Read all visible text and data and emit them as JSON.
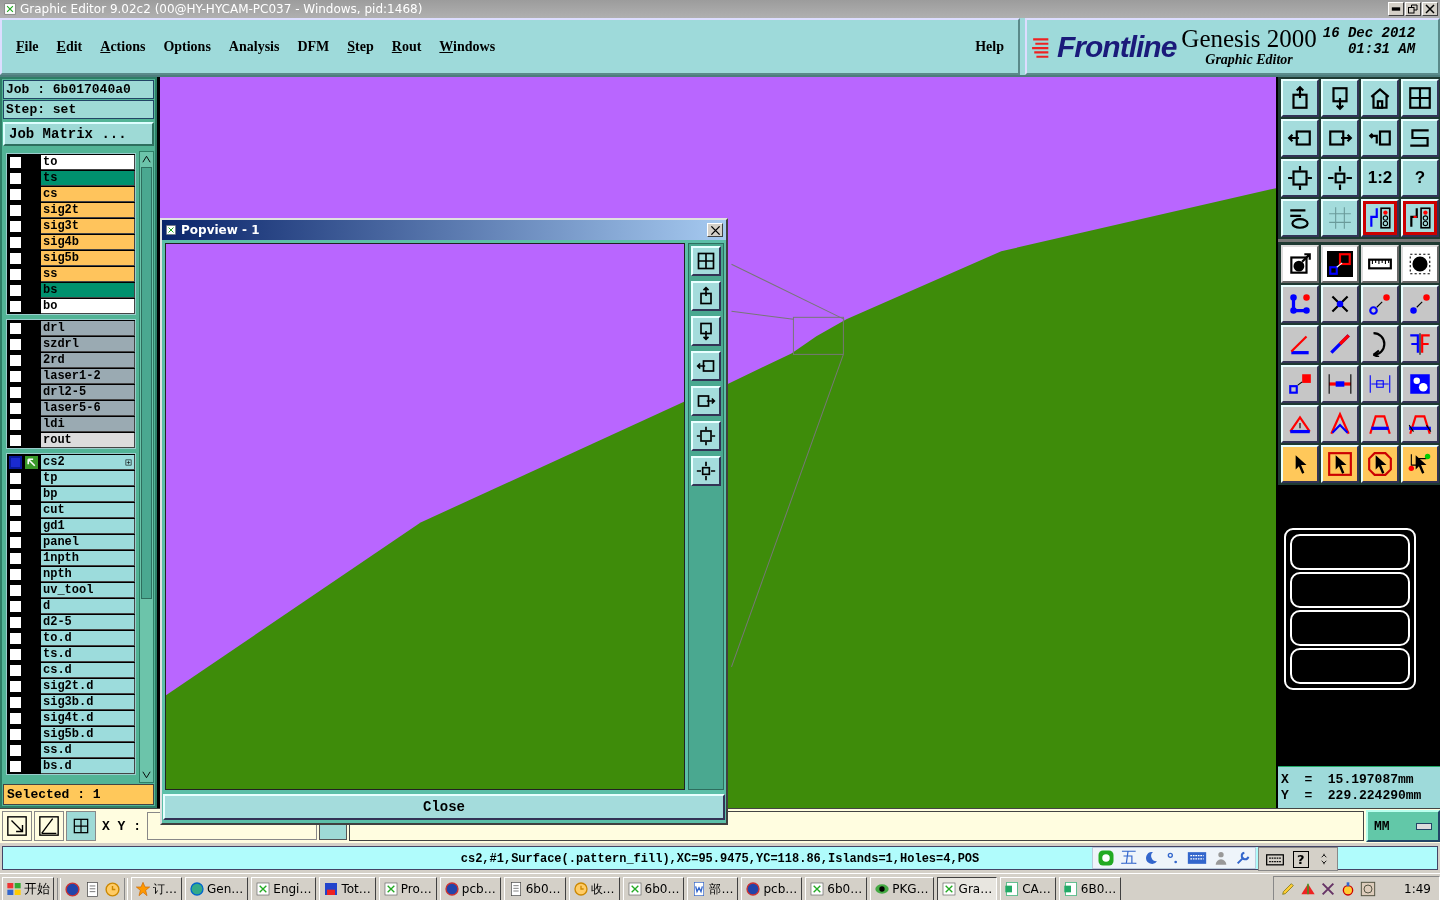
{
  "window": {
    "title": "Graphic Editor 9.02c2 (00@HY-HYCAM-PC037 - Windows, pid:1468)"
  },
  "menu": [
    {
      "label": "File",
      "mnemonic": true
    },
    {
      "label": "Edit",
      "mnemonic": true
    },
    {
      "label": "Actions",
      "mnemonic": true
    },
    {
      "label": "Options",
      "mnemonic": false
    },
    {
      "label": "Analysis",
      "mnemonic": false
    },
    {
      "label": "DFM",
      "mnemonic": false
    },
    {
      "label": "Step",
      "mnemonic": true
    },
    {
      "label": "Rout",
      "mnemonic": true
    },
    {
      "label": "Windows",
      "mnemonic": true
    }
  ],
  "help": "Help",
  "brand": {
    "logo": "Frontline",
    "product": "Genesis 2000",
    "subtitle": "Graphic Editor",
    "date": "16 Dec 2012",
    "time": "01:31 AM"
  },
  "job": {
    "job": "Job : 6b017040a0",
    "step": "Step: set",
    "matrix_button": "Job Matrix ..."
  },
  "layer_groups": [
    {
      "layers": [
        {
          "name": "to",
          "color": "#ffffff",
          "selected": false
        },
        {
          "name": "ts",
          "color": "#00916e",
          "selected": false
        },
        {
          "name": "cs",
          "color": "#ffc45c",
          "selected": false
        },
        {
          "name": "sig2t",
          "color": "#ffc45c",
          "selected": false
        },
        {
          "name": "sig3t",
          "color": "#ffc45c",
          "selected": false
        },
        {
          "name": "sig4b",
          "color": "#ffc45c",
          "selected": false
        },
        {
          "name": "sig5b",
          "color": "#ffc45c",
          "selected": false
        },
        {
          "name": "ss",
          "color": "#ffc45c",
          "selected": false
        },
        {
          "name": "bs",
          "color": "#00916e",
          "selected": false
        },
        {
          "name": "bo",
          "color": "#ffffff",
          "selected": false
        }
      ]
    },
    {
      "layers": [
        {
          "name": "drl",
          "color": "#9aaab2",
          "selected": false
        },
        {
          "name": "szdrl",
          "color": "#9aaab2",
          "selected": false
        },
        {
          "name": "2rd",
          "color": "#9aaab2",
          "selected": false
        },
        {
          "name": "laser1-2",
          "color": "#9aaab2",
          "selected": false
        },
        {
          "name": "drl2-5",
          "color": "#9aaab2",
          "selected": false
        },
        {
          "name": "laser5-6",
          "color": "#9aaab2",
          "selected": false
        },
        {
          "name": "ldi",
          "color": "#9aaab2",
          "selected": false
        },
        {
          "name": "rout",
          "color": "#dcdcdc",
          "selected": false
        }
      ]
    },
    {
      "layers": [
        {
          "name": "cs2",
          "color": "#9cdcdc",
          "selected": true
        },
        {
          "name": "tp",
          "color": "#9cdcdc",
          "selected": false
        },
        {
          "name": "bp",
          "color": "#9cdcdc",
          "selected": false
        },
        {
          "name": "cut",
          "color": "#9cdcdc",
          "selected": false
        },
        {
          "name": "gd1",
          "color": "#9cdcdc",
          "selected": false
        },
        {
          "name": "panel",
          "color": "#9cdcdc",
          "selected": false
        },
        {
          "name": "1npth",
          "color": "#9cdcdc",
          "selected": false
        },
        {
          "name": "npth",
          "color": "#9cdcdc",
          "selected": false
        },
        {
          "name": "uv_tool",
          "color": "#9cdcdc",
          "selected": false
        },
        {
          "name": "d",
          "color": "#9cdcdc",
          "selected": false
        },
        {
          "name": "d2-5",
          "color": "#9cdcdc",
          "selected": false
        },
        {
          "name": "to.d",
          "color": "#9cdcdc",
          "selected": false
        },
        {
          "name": "ts.d",
          "color": "#9cdcdc",
          "selected": false
        },
        {
          "name": "cs.d",
          "color": "#9cdcdc",
          "selected": false
        },
        {
          "name": "sig2t.d",
          "color": "#9cdcdc",
          "selected": false
        },
        {
          "name": "sig3b.d",
          "color": "#9cdcdc",
          "selected": false
        },
        {
          "name": "sig4t.d",
          "color": "#9cdcdc",
          "selected": false
        },
        {
          "name": "sig5b.d",
          "color": "#9cdcdc",
          "selected": false
        },
        {
          "name": "ss.d",
          "color": "#9cdcdc",
          "selected": false
        },
        {
          "name": "bs.d",
          "color": "#9cdcdc",
          "selected": false
        }
      ]
    }
  ],
  "selected_count": "Selected : 1",
  "view_toolbar": [
    {
      "on": false
    },
    {
      "on": false
    },
    {
      "on": false
    },
    {
      "on": false
    },
    {
      "on": false
    },
    {
      "on": false
    },
    {
      "on": false
    },
    {
      "on": false
    },
    {
      "on": false
    },
    {
      "on": false
    },
    {
      "label": "1:2",
      "on": false
    },
    {
      "label": "?",
      "on": false
    },
    {
      "on": false
    },
    {
      "on": false
    },
    {
      "on": true
    },
    {
      "on": true
    }
  ],
  "coordinates": {
    "x": "X  =  15.197087mm",
    "y": "Y  =  229.224290mm"
  },
  "popview": {
    "title": "Popview - 1",
    "close": "Close"
  },
  "bottom": {
    "xy_label": "X Y :",
    "units": "MM"
  },
  "status": "cs2,#1,Surface(.pattern_fill),XC=95.9475,YC=118.86,Islands=1,Holes=4,POS",
  "ime": {
    "mode": "五",
    "help": "?"
  },
  "taskbar": {
    "start": "开始",
    "tasks": [
      {
        "label": "订…",
        "kind": "star",
        "selected": false
      },
      {
        "label": "Gen…",
        "kind": "globe-app",
        "selected": false
      },
      {
        "label": "Engi…",
        "kind": "editor",
        "selected": false
      },
      {
        "label": "Tot…",
        "kind": "disk",
        "selected": false
      },
      {
        "label": "Pro…",
        "kind": "editor",
        "selected": false
      },
      {
        "label": "pcb…",
        "kind": "globe",
        "selected": false
      },
      {
        "label": "6b0…",
        "kind": "notepad",
        "selected": false
      },
      {
        "label": "收…",
        "kind": "clock",
        "selected": false
      },
      {
        "label": "6b0…",
        "kind": "editor",
        "selected": false
      },
      {
        "label": "部…",
        "kind": "document",
        "selected": false
      },
      {
        "label": "pcb…",
        "kind": "globe",
        "selected": false
      },
      {
        "label": "6b0…",
        "kind": "editor",
        "selected": false
      },
      {
        "label": "PKG…",
        "kind": "eye",
        "selected": false
      },
      {
        "label": "Gra…",
        "kind": "editor",
        "selected": true
      },
      {
        "label": "CA…",
        "kind": "sheet",
        "selected": false
      },
      {
        "label": "6B0…",
        "kind": "sheet",
        "selected": false
      }
    ],
    "clock": "1:49"
  }
}
